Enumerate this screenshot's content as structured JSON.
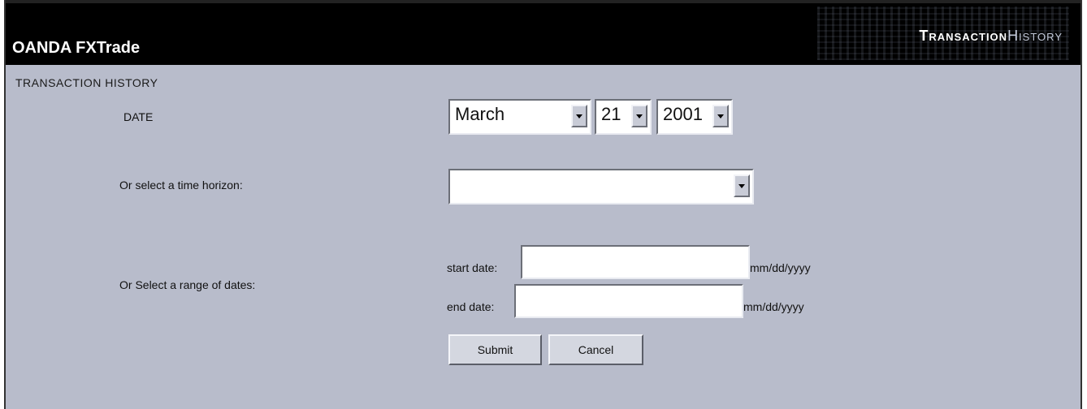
{
  "header": {
    "app_title": "OANDA FXTrade",
    "banner_title_part1": "Transaction",
    "banner_title_part2": "History"
  },
  "form": {
    "section_title": "TRANSACTION HISTORY",
    "date_label": "DATE",
    "month": "March",
    "day": "21",
    "year": "2001",
    "horizon_label": "Or select a time horizon:",
    "horizon_value": "",
    "range_label": "Or Select a range of dates:",
    "start_label": "start date:",
    "start_value": "",
    "start_hint": "mm/dd/yyyy",
    "end_label": "end date:",
    "end_value": "",
    "end_hint": "mm/dd/yyyy",
    "submit_label": "Submit",
    "cancel_label": "Cancel"
  }
}
